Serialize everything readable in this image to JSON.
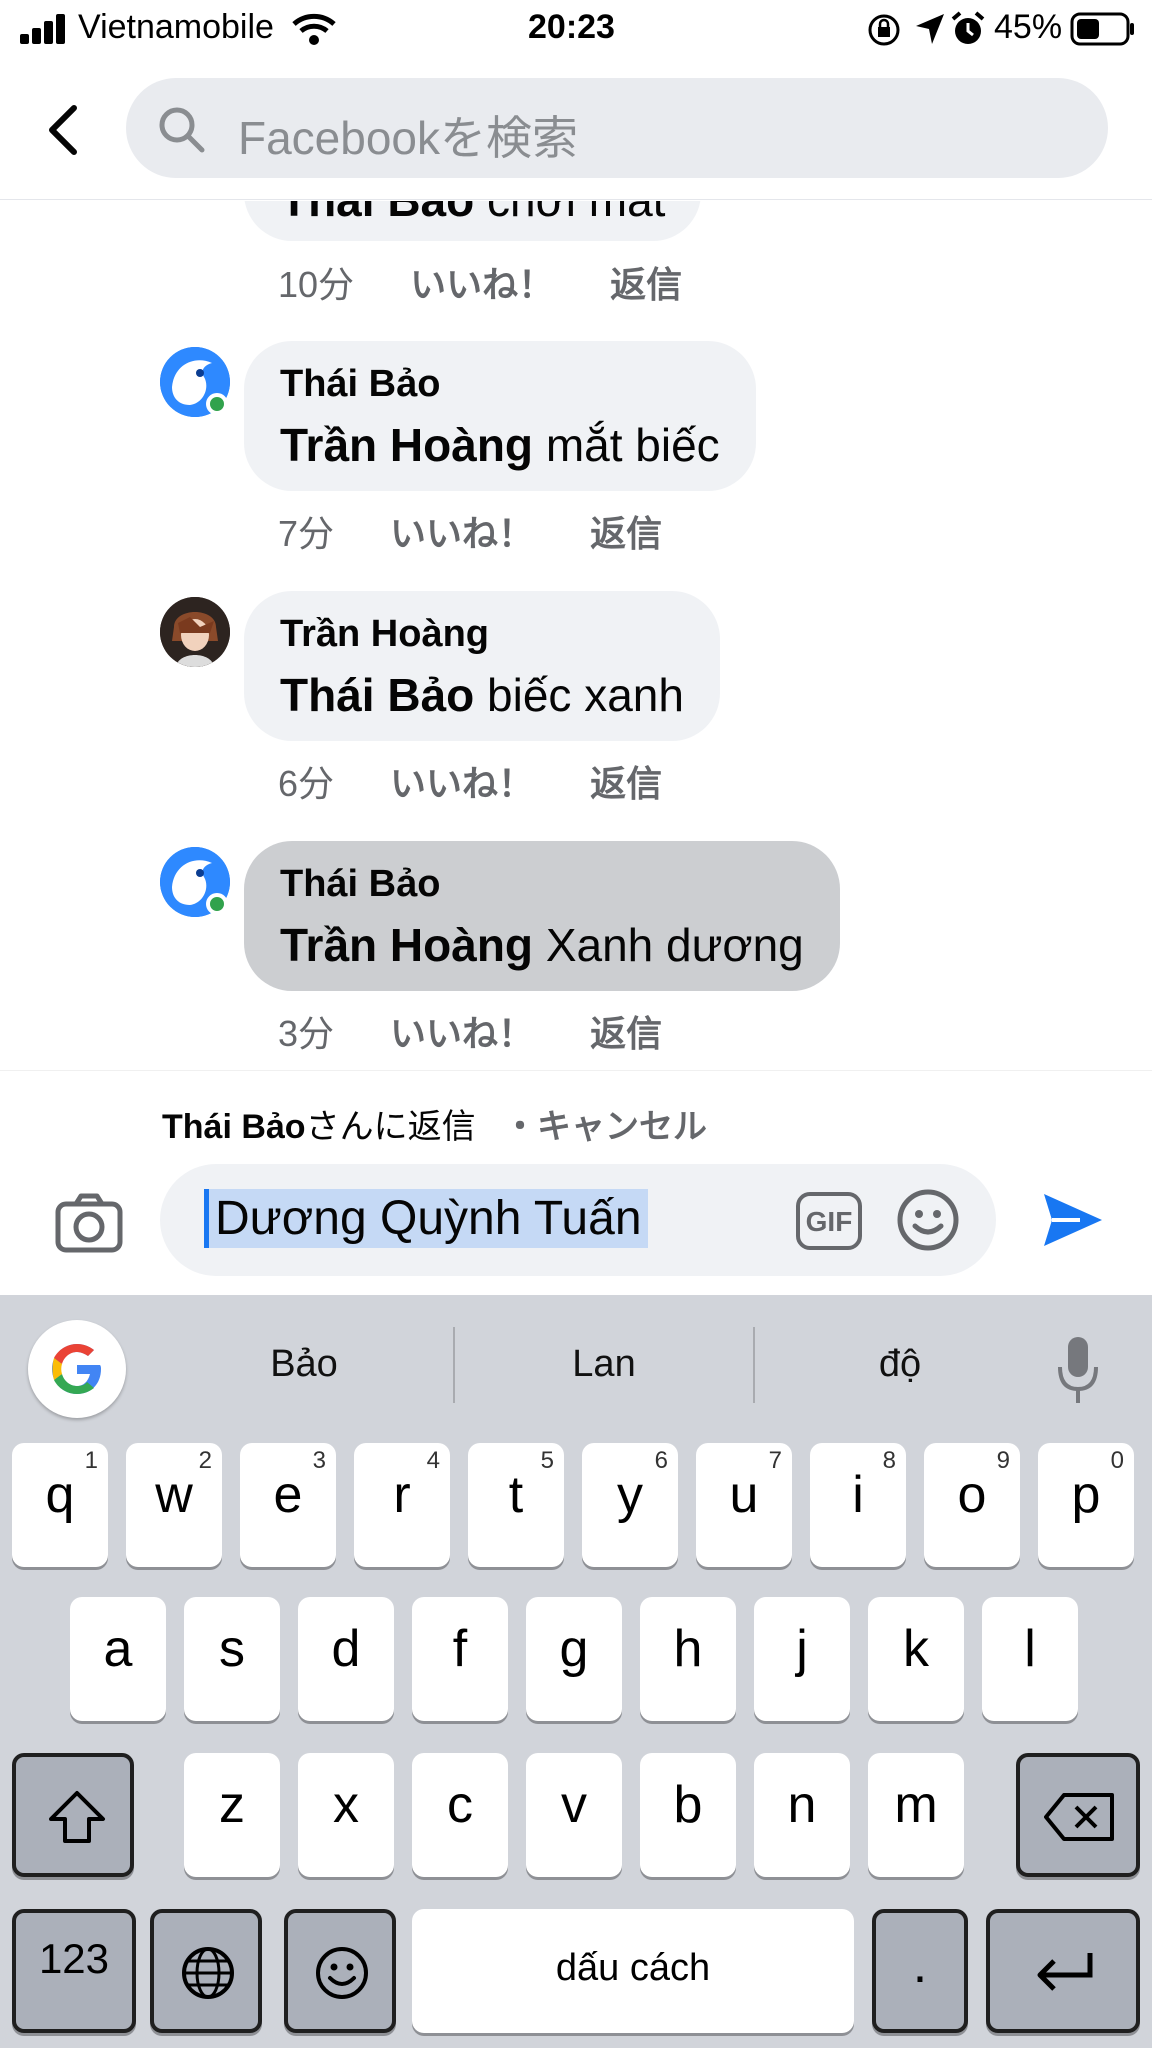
{
  "status_bar": {
    "carrier": "Vietnamobile",
    "time": "20:23",
    "battery": "45%"
  },
  "header": {
    "search_placeholder": "Facebookを検索"
  },
  "comments": [
    {
      "author": "Thái Bảo",
      "mention": "Trần Hoàng",
      "text": "mắt biếc",
      "time": "7分",
      "like": "いいね！",
      "reply": "返信",
      "avatar": "blue-bird-avatar",
      "online": true
    },
    {
      "author": "Trần Hoàng",
      "mention": "Thái Bảo",
      "text": "biếc xanh",
      "time": "6分",
      "like": "いいね！",
      "reply": "返信",
      "avatar": "anime-avatar",
      "online": false
    },
    {
      "author": "Thái Bảo",
      "mention": "Trần Hoàng",
      "text": "Xanh dương",
      "time": "3分",
      "like": "いいね！",
      "reply": "返信",
      "avatar": "blue-bird-avatar",
      "online": true
    }
  ],
  "partial_comment": {
    "mention": "Thái Bảo",
    "text": "chơi mát",
    "time": "10分",
    "like": "いいね！",
    "reply": "返信"
  },
  "reply_bar": {
    "name": "Thái Bảo",
    "suffix": "さんに返信",
    "cancel": "・キャンセル"
  },
  "composer": {
    "value": "Dương Quỳnh Tuấn",
    "gif_label": "GIF"
  },
  "keyboard": {
    "suggestions": [
      "Bảo",
      "Lan",
      "độ"
    ],
    "row1": [
      {
        "k": "q",
        "n": "1"
      },
      {
        "k": "w",
        "n": "2"
      },
      {
        "k": "e",
        "n": "3"
      },
      {
        "k": "r",
        "n": "4"
      },
      {
        "k": "t",
        "n": "5"
      },
      {
        "k": "y",
        "n": "6"
      },
      {
        "k": "u",
        "n": "7"
      },
      {
        "k": "i",
        "n": "8"
      },
      {
        "k": "o",
        "n": "9"
      },
      {
        "k": "p",
        "n": "0"
      }
    ],
    "row2": [
      "a",
      "s",
      "d",
      "f",
      "g",
      "h",
      "j",
      "k",
      "l"
    ],
    "row3": [
      "z",
      "x",
      "c",
      "v",
      "b",
      "n",
      "m"
    ],
    "numbers_label": "123",
    "space_label": "dấu cách",
    "period_label": "."
  },
  "colors": {
    "accent": "#1877f2",
    "online": "#31a24c",
    "bubble": "#f0f2f5",
    "bubble_active": "#ccced1",
    "keyboard_bg": "#d1d4da"
  }
}
